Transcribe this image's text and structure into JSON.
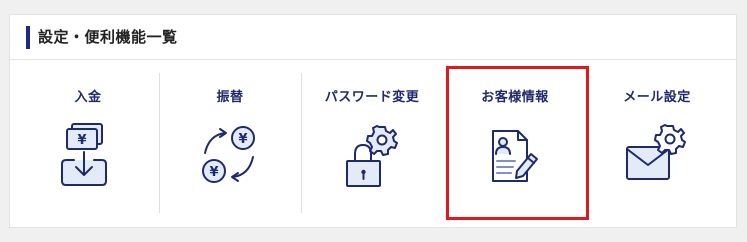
{
  "panel": {
    "title": "設定・便利機能一覧"
  },
  "menu": {
    "items": [
      {
        "label": "入金",
        "icon": "deposit-icon"
      },
      {
        "label": "振替",
        "icon": "transfer-icon"
      },
      {
        "label": "パスワード変更",
        "icon": "password-change-icon"
      },
      {
        "label": "お客様情報",
        "icon": "customer-info-icon"
      },
      {
        "label": "メール設定",
        "icon": "mail-settings-icon"
      }
    ]
  },
  "highlighted_item": "お客様情報",
  "colors": {
    "accent": "#1e2a8a",
    "label": "#1e2a6e",
    "icon_fill": "#e4ebf8",
    "highlight": "#e0191e"
  }
}
